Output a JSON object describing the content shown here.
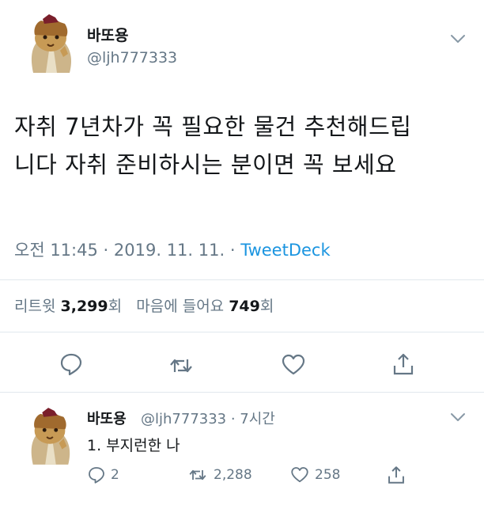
{
  "tweet": {
    "display_name": "바또용",
    "handle": "@ljh777333",
    "text_line1": "자취 7년차가 꼭 필요한 물건 추천해드립",
    "text_line2": "니다 자취 준비하시는 분이면 꼭 보세요",
    "time": "오전 11:45",
    "date": "2019. 11. 11.",
    "client": "TweetDeck",
    "sep": "·",
    "retweets_label": "리트윗",
    "retweets_count": "3,299",
    "retweets_unit": "회",
    "likes_label": "마음에 들어요",
    "likes_count": "749",
    "likes_unit": "회"
  },
  "reply": {
    "display_name": "바또용",
    "handle_time": "@ljh777333 · 7시간",
    "text": "1. 부지런한 나",
    "reply_count": "2",
    "retweet_count": "2,288",
    "like_count": "258"
  },
  "icons": {
    "reply": "reply-bubble-icon",
    "retweet": "retweet-icon",
    "like": "heart-icon",
    "share": "share-icon",
    "menu": "chevron-down-icon"
  },
  "colors": {
    "link": "#1b95e0",
    "muted": "#657786",
    "text": "#14171a",
    "divider": "#e1e8ed"
  }
}
